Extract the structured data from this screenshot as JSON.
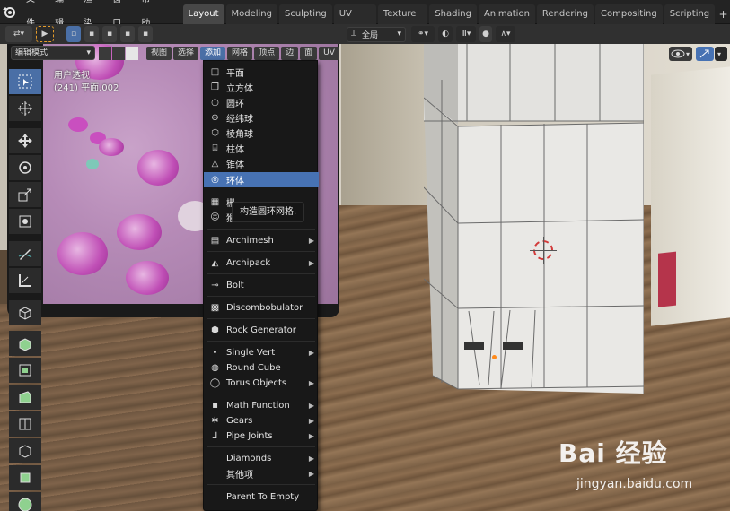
{
  "topbar": {
    "menus": [
      "文件",
      "编辑",
      "渲染",
      "窗口",
      "帮助"
    ],
    "tabs": [
      {
        "label": "Layout",
        "active": true
      },
      {
        "label": "Modeling",
        "active": false
      },
      {
        "label": "Sculpting",
        "active": false
      },
      {
        "label": "UV Editing",
        "active": false
      },
      {
        "label": "Texture Paint",
        "active": false
      },
      {
        "label": "Shading",
        "active": false
      },
      {
        "label": "Animation",
        "active": false
      },
      {
        "label": "Rendering",
        "active": false
      },
      {
        "label": "Compositing",
        "active": false
      },
      {
        "label": "Scripting",
        "active": false
      }
    ],
    "add_tab": "+"
  },
  "toolheader": {
    "orientation": "全局"
  },
  "viewport_header": {
    "mode": "编辑模式",
    "menus": [
      {
        "label": "视图",
        "active": false
      },
      {
        "label": "选择",
        "active": false
      },
      {
        "label": "添加",
        "active": true
      },
      {
        "label": "网格",
        "active": false
      },
      {
        "label": "顶点",
        "active": false
      },
      {
        "label": "边",
        "active": false
      },
      {
        "label": "面",
        "active": false
      },
      {
        "label": "UV",
        "active": false
      }
    ]
  },
  "viewport_info": {
    "view_name": "用户透视",
    "object_info": "(241) 平面.002"
  },
  "add_menu": {
    "items": [
      {
        "label": "平面",
        "icon": "plane-icon",
        "glyph": "□",
        "submenu": false,
        "highlighted": false
      },
      {
        "label": "立方体",
        "icon": "cube-icon",
        "glyph": "❒",
        "submenu": false,
        "highlighted": false
      },
      {
        "label": "圆环",
        "icon": "circle-icon",
        "glyph": "○",
        "submenu": false,
        "highlighted": false
      },
      {
        "label": "经纬球",
        "icon": "uv-sphere-icon",
        "glyph": "⊕",
        "submenu": false,
        "highlighted": false
      },
      {
        "label": "棱角球",
        "icon": "ico-sphere-icon",
        "glyph": "⬡",
        "submenu": false,
        "highlighted": false
      },
      {
        "label": "柱体",
        "icon": "cylinder-icon",
        "glyph": "⌸",
        "submenu": false,
        "highlighted": false
      },
      {
        "label": "锥体",
        "icon": "cone-icon",
        "glyph": "△",
        "submenu": false,
        "highlighted": false
      },
      {
        "label": "环体",
        "icon": "torus-icon",
        "glyph": "◎",
        "submenu": false,
        "highlighted": true
      },
      {
        "label": "栅",
        "icon": "grid-icon",
        "glyph": "▦",
        "submenu": false,
        "highlighted": false
      },
      {
        "label": "猴",
        "icon": "monkey-icon",
        "glyph": "☺",
        "submenu": false,
        "highlighted": false
      },
      {
        "label": "Archimesh",
        "icon": "archimesh-icon",
        "glyph": "▤",
        "submenu": true,
        "highlighted": false
      },
      {
        "label": "Archipack",
        "icon": "archipack-icon",
        "glyph": "◭",
        "submenu": true,
        "highlighted": false
      },
      {
        "label": "Bolt",
        "icon": "bolt-icon",
        "glyph": "⊸",
        "submenu": false,
        "highlighted": false
      },
      {
        "label": "Discombobulator",
        "icon": "discombobulator-icon",
        "glyph": "▩",
        "submenu": false,
        "highlighted": false
      },
      {
        "label": "Rock Generator",
        "icon": "rock-generator-icon",
        "glyph": "⬢",
        "submenu": false,
        "highlighted": false
      },
      {
        "label": "Single Vert",
        "icon": "single-vert-icon",
        "glyph": "•",
        "submenu": true,
        "highlighted": false
      },
      {
        "label": "Round Cube",
        "icon": "round-cube-icon",
        "glyph": "◍",
        "submenu": false,
        "highlighted": false
      },
      {
        "label": "Torus Objects",
        "icon": "torus-objects-icon",
        "glyph": "◯",
        "submenu": true,
        "highlighted": false
      },
      {
        "label": "Math Function",
        "icon": "math-function-icon",
        "glyph": "▪",
        "submenu": true,
        "highlighted": false
      },
      {
        "label": "Gears",
        "icon": "gears-icon",
        "glyph": "✲",
        "submenu": true,
        "highlighted": false
      },
      {
        "label": "Pipe Joints",
        "icon": "pipe-joints-icon",
        "glyph": "⅃",
        "submenu": true,
        "highlighted": false
      },
      {
        "label": "Diamonds",
        "icon": "",
        "glyph": "",
        "submenu": true,
        "highlighted": false
      },
      {
        "label": "其他项",
        "icon": "",
        "glyph": "",
        "submenu": true,
        "highlighted": false
      },
      {
        "label": "Parent To Empty",
        "icon": "",
        "glyph": "",
        "submenu": false,
        "highlighted": false
      }
    ],
    "tooltip": "构造圆环网格."
  },
  "watermark": {
    "logo_text": "Bai  经验",
    "url": "jingyan.baidu.com"
  },
  "colors": {
    "accent": "#4772b3",
    "active_tab": "#474747",
    "menu_bg": "#181818"
  }
}
